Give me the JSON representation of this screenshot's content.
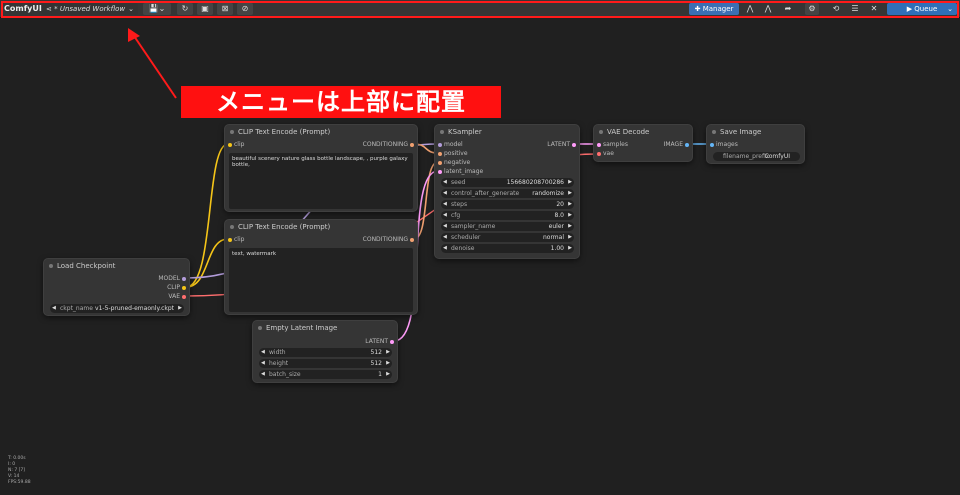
{
  "topbar": {
    "brand": "ComfyUI",
    "workflow_name": "* Unsaved Workflow",
    "manager_label": "Manager",
    "queue_label": "Queue"
  },
  "annotation": {
    "text": "メニューは上部に配置"
  },
  "nodes": {
    "clip_pos": {
      "title": "CLIP Text Encode (Prompt)",
      "input": "clip",
      "output": "CONDITIONING",
      "text": "beautiful scenery nature glass bottle landscape, , purple galaxy bottle,"
    },
    "clip_neg": {
      "title": "CLIP Text Encode (Prompt)",
      "input": "clip",
      "output": "CONDITIONING",
      "text": "text, watermark"
    },
    "ksampler": {
      "title": "KSampler",
      "inputs": [
        "model",
        "positive",
        "negative",
        "latent_image"
      ],
      "output": "LATENT",
      "widgets": [
        {
          "name": "seed",
          "value": "156680208700286"
        },
        {
          "name": "control_after_generate",
          "value": "randomize"
        },
        {
          "name": "steps",
          "value": "20"
        },
        {
          "name": "cfg",
          "value": "8.0"
        },
        {
          "name": "sampler_name",
          "value": "euler"
        },
        {
          "name": "scheduler",
          "value": "normal"
        },
        {
          "name": "denoise",
          "value": "1.00"
        }
      ]
    },
    "vae_decode": {
      "title": "VAE Decode",
      "inputs": [
        "samples",
        "vae"
      ],
      "output": "IMAGE"
    },
    "save_image": {
      "title": "Save Image",
      "input": "images",
      "widget_name": "filename_prefix",
      "widget_value": "ComfyUI"
    },
    "load_checkpoint": {
      "title": "Load Checkpoint",
      "outputs": [
        "MODEL",
        "CLIP",
        "VAE"
      ],
      "widget_name": "ckpt_name",
      "widget_value": "v1-5-pruned-emaonly.ckpt"
    },
    "empty_latent": {
      "title": "Empty Latent Image",
      "output": "LATENT",
      "widgets": [
        {
          "name": "width",
          "value": "512"
        },
        {
          "name": "height",
          "value": "512"
        },
        {
          "name": "batch_size",
          "value": "1"
        }
      ]
    }
  },
  "status": [
    "T: 0.00s",
    "I: 0",
    "N: 7 [7]",
    "V: 14",
    "FPS:59.88"
  ],
  "colors": {
    "clip": "#f5c518",
    "model": "#b39ddb",
    "conditioning": "#f0a070",
    "latent": "#ff9cf9",
    "vae": "#ff6e6e",
    "image": "#64b5f6",
    "highlight": "#ff1a1a"
  }
}
